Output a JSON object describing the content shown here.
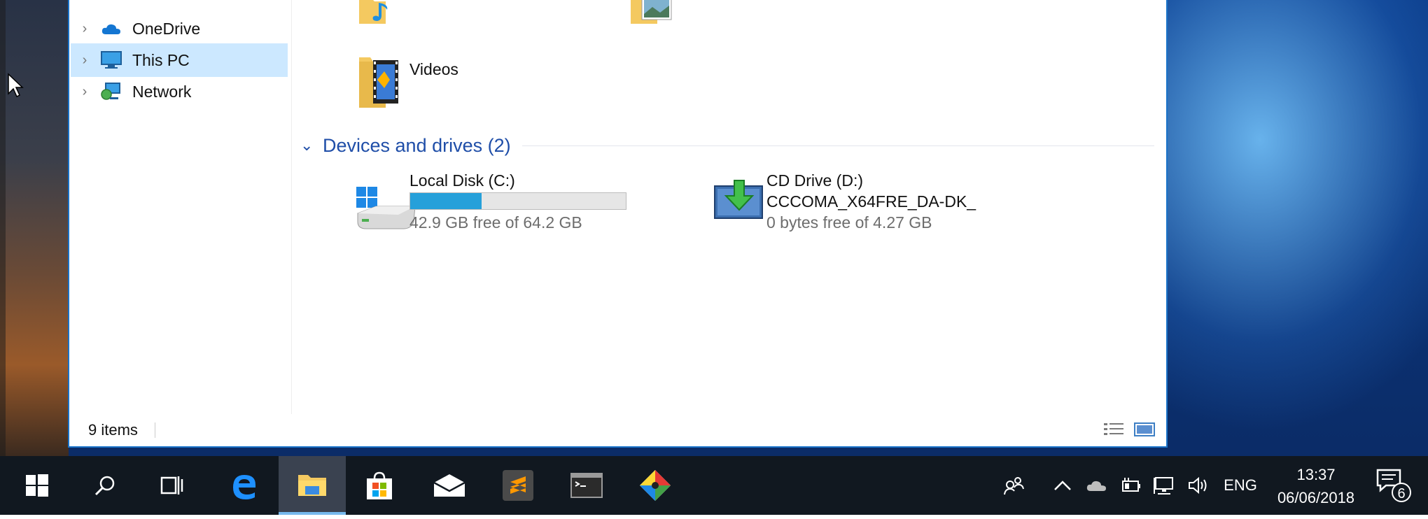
{
  "nav": {
    "items": [
      {
        "label": "OneDrive",
        "icon": "onedrive-cloud-icon",
        "selected": false
      },
      {
        "label": "This PC",
        "icon": "this-pc-monitor-icon",
        "selected": true
      },
      {
        "label": "Network",
        "icon": "network-icon",
        "selected": false
      }
    ]
  },
  "content": {
    "folders": [
      {
        "label": "Videos",
        "icon": "videos-folder-icon"
      }
    ],
    "group": {
      "title": "Devices and drives (2)"
    },
    "drives": [
      {
        "name": "Local Disk (C:)",
        "free_text": "42.9 GB free of 64.2 GB",
        "used_fraction": 0.33,
        "icon": "windows-disk-icon"
      },
      {
        "name": "CD Drive (D:)",
        "label": "CCCOMA_X64FRE_DA-DK_",
        "free_text": "0 bytes free of 4.27 GB",
        "icon": "cd-drive-icon"
      }
    ]
  },
  "status": {
    "item_count": "9 items"
  },
  "taskbar": {
    "apps": [
      {
        "name": "start-button",
        "icon": "windows-logo-icon"
      },
      {
        "name": "search-button",
        "icon": "search-icon"
      },
      {
        "name": "task-view-button",
        "icon": "task-view-icon"
      },
      {
        "name": "edge-button",
        "icon": "edge-icon"
      },
      {
        "name": "file-explorer-button",
        "icon": "file-explorer-icon",
        "active": true
      },
      {
        "name": "store-button",
        "icon": "store-icon"
      },
      {
        "name": "mail-button",
        "icon": "mail-icon"
      },
      {
        "name": "sublime-button",
        "icon": "sublime-text-icon"
      },
      {
        "name": "terminal-button",
        "icon": "terminal-icon"
      },
      {
        "name": "git-button",
        "icon": "git-icon"
      }
    ],
    "tray": {
      "language": "ENG",
      "time": "13:37",
      "date": "06/06/2018",
      "notification_count": "6"
    }
  },
  "colors": {
    "accent": "#1a73c9",
    "selection": "#cce8ff",
    "group_header": "#1f4ea8",
    "disk_bar": "#26a0da"
  }
}
